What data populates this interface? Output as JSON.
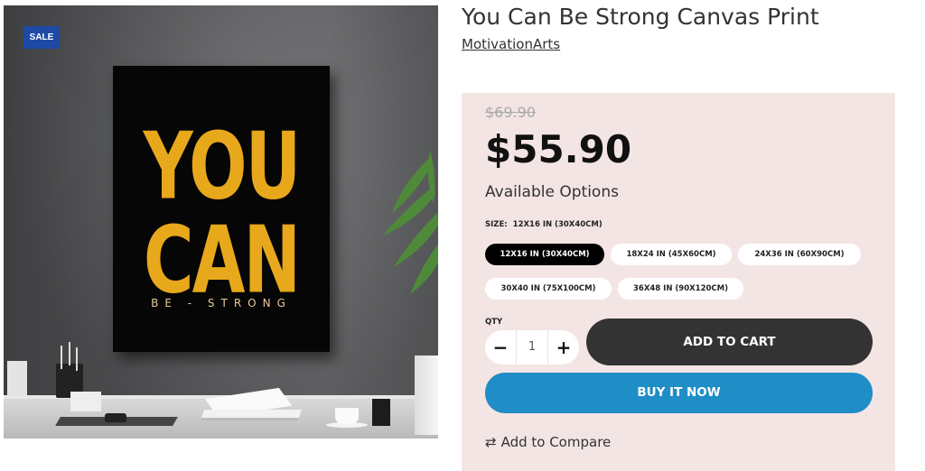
{
  "product": {
    "title": "You Can Be Strong Canvas Print",
    "vendor": "MotivationArts",
    "badge": "SALE",
    "image_text": {
      "line1": "YOU",
      "line2": "CAN",
      "line3": "BE - STRONG"
    }
  },
  "pricing": {
    "compare_at": "$69.90",
    "price": "$55.90"
  },
  "options": {
    "heading": "Available Options",
    "size_label": "SIZE:",
    "selected_size": "12X16 IN (30X40CM)",
    "sizes": [
      {
        "label": "12X16 IN (30X40CM)",
        "selected": true
      },
      {
        "label": "18X24 IN (45X60CM)",
        "selected": false
      },
      {
        "label": "24X36 IN (60X90CM)",
        "selected": false
      },
      {
        "label": "30X40 IN (75X100CM)",
        "selected": false
      },
      {
        "label": "36X48 IN (90X120CM)",
        "selected": false
      }
    ]
  },
  "quantity": {
    "label": "QTY",
    "value": "1",
    "minus": "−",
    "plus": "+"
  },
  "actions": {
    "add_to_cart": "ADD TO CART",
    "buy_now": "BUY IT NOW",
    "compare": "Add to Compare",
    "compare_icon": "compare-arrows-icon"
  },
  "colors": {
    "badge": "#1e4aa6",
    "panel_bg": "#f4e5e5",
    "add_to_cart_bg": "#333333",
    "buy_now_bg": "#1f8dc6",
    "poster_yellow": "#e8a81c"
  }
}
